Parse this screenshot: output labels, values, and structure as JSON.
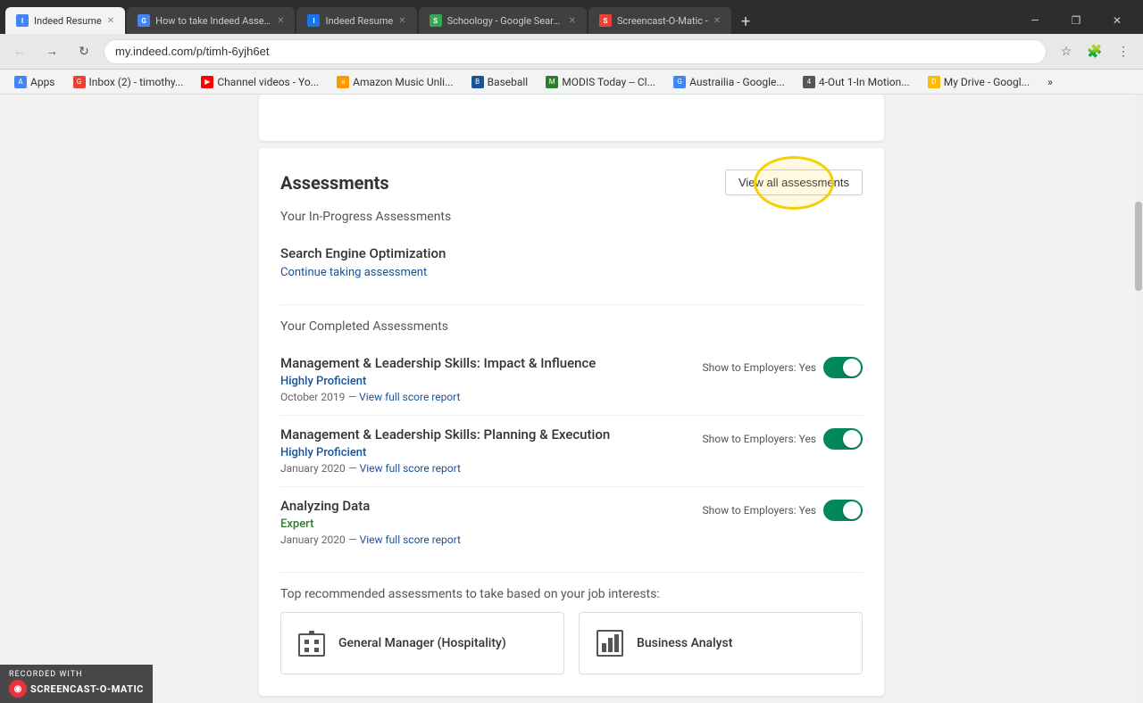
{
  "browser": {
    "tabs": [
      {
        "id": "tab1",
        "favicon_color": "#4285f4",
        "favicon_letter": "I",
        "title": "Indeed Resume",
        "active": true
      },
      {
        "id": "tab2",
        "favicon_color": "#4285f4",
        "favicon_letter": "G",
        "title": "How to take Indeed Assessme...",
        "active": false
      },
      {
        "id": "tab3",
        "favicon_color": "#1a73e8",
        "favicon_letter": "I",
        "title": "Indeed Resume",
        "active": false
      },
      {
        "id": "tab4",
        "favicon_color": "#34a853",
        "favicon_letter": "S",
        "title": "Schoology - Google Search",
        "active": false
      },
      {
        "id": "tab5",
        "favicon_color": "#ea4335",
        "favicon_letter": "S",
        "title": "Screencast-O-Matic -",
        "active": false
      }
    ],
    "address": "my.indeed.com/p/timh-6yjh6et",
    "bookmarks": [
      {
        "label": "Apps",
        "icon": "A"
      },
      {
        "label": "Inbox (2) - timothy...",
        "icon": "G"
      },
      {
        "label": "Channel videos - Yo...",
        "icon": "Y"
      },
      {
        "label": "Amazon Music Unli...",
        "icon": "a"
      },
      {
        "label": "Baseball",
        "icon": "B"
      },
      {
        "label": "MODIS Today -- Cl...",
        "icon": "M"
      },
      {
        "label": "Austrailia - Google...",
        "icon": "G"
      },
      {
        "label": "4-Out 1-In Motion...",
        "icon": "4"
      },
      {
        "label": "My Drive - Googl...",
        "icon": "D"
      }
    ]
  },
  "page": {
    "assessments_section": {
      "title": "Assessments",
      "view_all_button": "View all assessments",
      "in_progress_title": "Your In-Progress Assessments",
      "in_progress": [
        {
          "name": "Search Engine Optimization",
          "action_label": "Continue taking assessment"
        }
      ],
      "completed_title": "Your Completed Assessments",
      "completed": [
        {
          "name": "Management & Leadership Skills: Impact & Influence",
          "level": "Highly Proficient",
          "level_type": "proficient",
          "date": "October 2019",
          "show_employer_label": "Show to Employers: Yes",
          "view_report_label": "View full score report",
          "toggle_on": true
        },
        {
          "name": "Management & Leadership Skills: Planning & Execution",
          "level": "Highly Proficient",
          "level_type": "proficient",
          "date": "January 2020",
          "show_employer_label": "Show to Employers: Yes",
          "view_report_label": "View full score report",
          "toggle_on": true
        },
        {
          "name": "Analyzing Data",
          "level": "Expert",
          "level_type": "expert",
          "date": "January 2020",
          "show_employer_label": "Show to Employers: Yes",
          "view_report_label": "View full score report",
          "toggle_on": true
        }
      ],
      "recommended_title": "Top recommended assessments to take based on your job interests:",
      "recommended": [
        {
          "label": "General Manager (Hospitality)",
          "icon": "building"
        },
        {
          "label": "Business Analyst",
          "icon": "chart"
        }
      ]
    }
  },
  "watermark": {
    "line1": "RECORDED WITH",
    "line2": "SCREENCAST-O-MATIC"
  }
}
